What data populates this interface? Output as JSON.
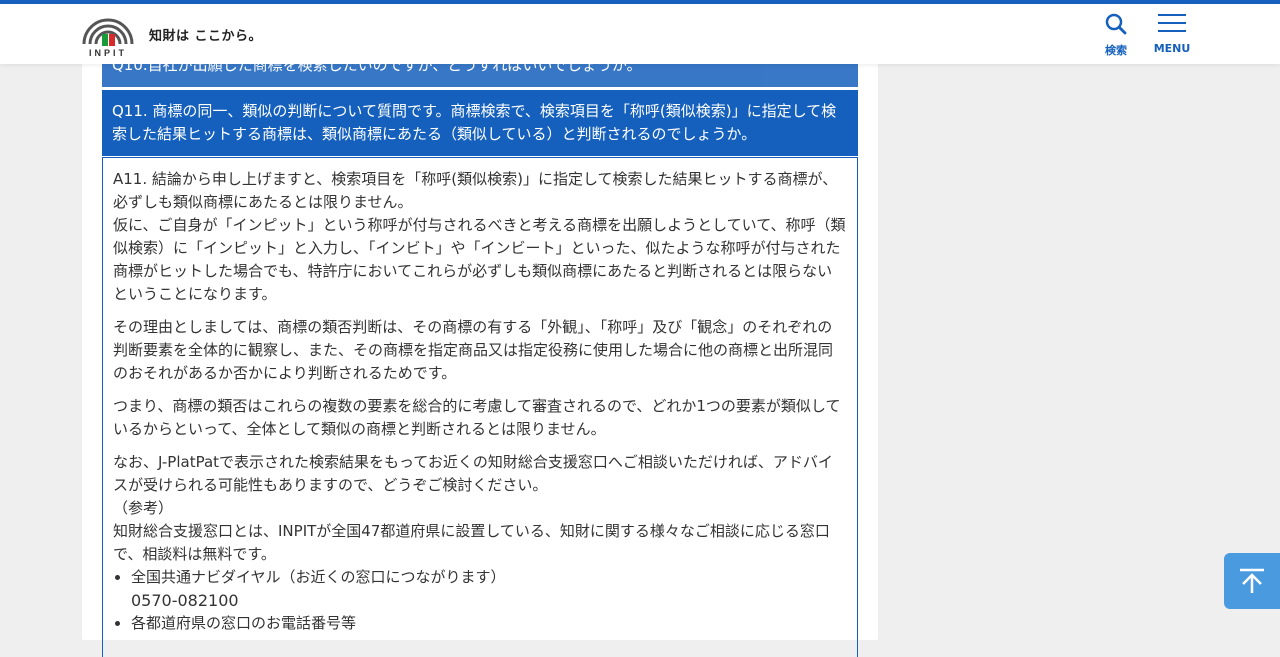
{
  "header": {
    "logo_text": "INPIT",
    "tagline": "知財は ここから。",
    "search_label": "検索",
    "menu_label": "MENU"
  },
  "colors": {
    "primary": "#1560bd",
    "to_top": "#4a9ae0",
    "background": "#efefef"
  },
  "faq": {
    "q10": "Q10.自社が出願した商標を検索したいのですが、どうすればいいでしょうか。",
    "q11": "Q11. 商標の同一、類似の判断について質問です。商標検索で、検索項目を「称呼(類似検索)」に指定して検索した結果ヒットする商標は、類似商標にあたる（類似している）と判断されるのでしょうか。",
    "a11": {
      "p1_line1": "A11. 結論から申し上げますと、検索項目を「称呼(類似検索)」に指定して検索した結果ヒットする商標が、必ずしも類似商標にあたるとは限りません。",
      "p1_line2": "仮に、ご自身が「インピット」という称呼が付与されるべきと考える商標を出願しようとしていて、称呼（類似検索）に「インピット」と入力し、「インビト」や「インビート」といった、似たような称呼が付与された商標がヒットした場合でも、特許庁においてこれらが必ずしも類似商標にあたると判断されるとは限らないということになります。",
      "p2": "その理由としましては、商標の類否判断は、その商標の有する「外観」、「称呼」及び「観念」のそれぞれの判断要素を全体的に観察し、また、その商標を指定商品又は指定役務に使用した場合に他の商標と出所混同のおそれがあるか否かにより判断されるためです。",
      "p3": "つまり、商標の類否はこれらの複数の要素を総合的に考慮して審査されるので、どれか1つの要素が類似しているからといって、全体として類似の商標と判断されるとは限りません。",
      "p4": "なお、J-PlatPatで表示された検索結果をもってお近くの知財総合支援窓口へご相談いただければ、アドバイスが受けられる可能性もありますので、どうぞご検討ください。",
      "ref_label": "（参考）",
      "p5": "知財総合支援窓口とは、INPITが全国47都道府県に設置している、知財に関する様々なご相談に応じる窓口で、相談料は無料です。",
      "list": [
        {
          "label": "全国共通ナビダイヤル（お近くの窓口につながります）",
          "value": "0570-082100"
        },
        {
          "label": "各都道府県の窓口のお電話番号等",
          "value": ""
        }
      ]
    }
  }
}
